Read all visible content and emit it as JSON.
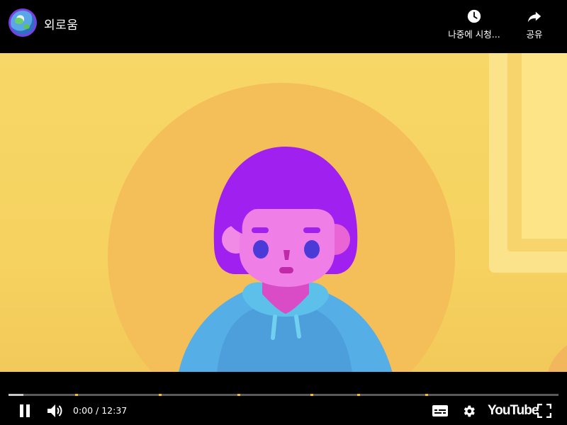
{
  "header": {
    "title": "외로움",
    "actions": [
      {
        "label": "나중에 시청...",
        "icon": "clock-icon"
      },
      {
        "label": "공유",
        "icon": "share-icon"
      }
    ]
  },
  "player": {
    "current_time": "0:00",
    "time_separator": "/",
    "duration": "12:37",
    "time_text": "0:00 / 12:37",
    "played_fraction": 0.027,
    "chapter_markers": [
      "chapter-1",
      "chapter-2",
      "chapter-3",
      "chapter-4",
      "chapter-5",
      "chapter-6"
    ],
    "logo_text": "YouTube",
    "icons": [
      "pause-icon",
      "volume-icon",
      "subtitles-icon",
      "settings-gear-icon",
      "fullscreen-icon"
    ]
  },
  "colors": {
    "background": "#000000",
    "video_bg": "#f6d25f",
    "sun_circle": "#f4bf5a",
    "hair": "#a020f0",
    "face": "#ef7fe6",
    "hoodie": "#55aee6",
    "progress_marker": "#f2b93b"
  }
}
